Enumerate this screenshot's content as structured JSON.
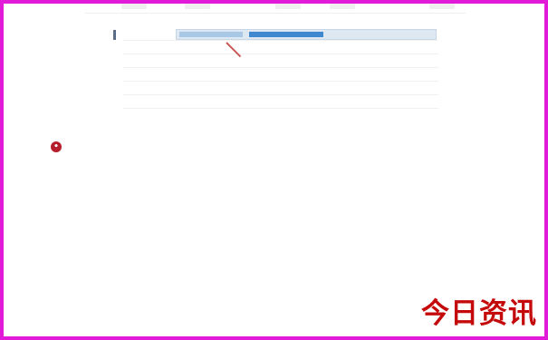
{
  "settings_table": {
    "rows": [
      {
        "label": "",
        "value": "",
        "extra": ""
      },
      {
        "label": "",
        "value": "",
        "extra": ""
      },
      {
        "label": "",
        "value": "",
        "extra": ""
      },
      {
        "label": "",
        "value": "",
        "extra": ""
      },
      {
        "label": "",
        "value": "",
        "extra": ""
      },
      {
        "label": "",
        "value": "",
        "extra": ""
      }
    ]
  },
  "note": {
    "line1": "",
    "line2": ""
  },
  "watermark": {
    "text": "今日资讯"
  },
  "colors": {
    "frame": "#e21bd8",
    "selection": "#3f88cf",
    "note_icon": "#b51e2c",
    "watermark": "#c40a0a"
  }
}
